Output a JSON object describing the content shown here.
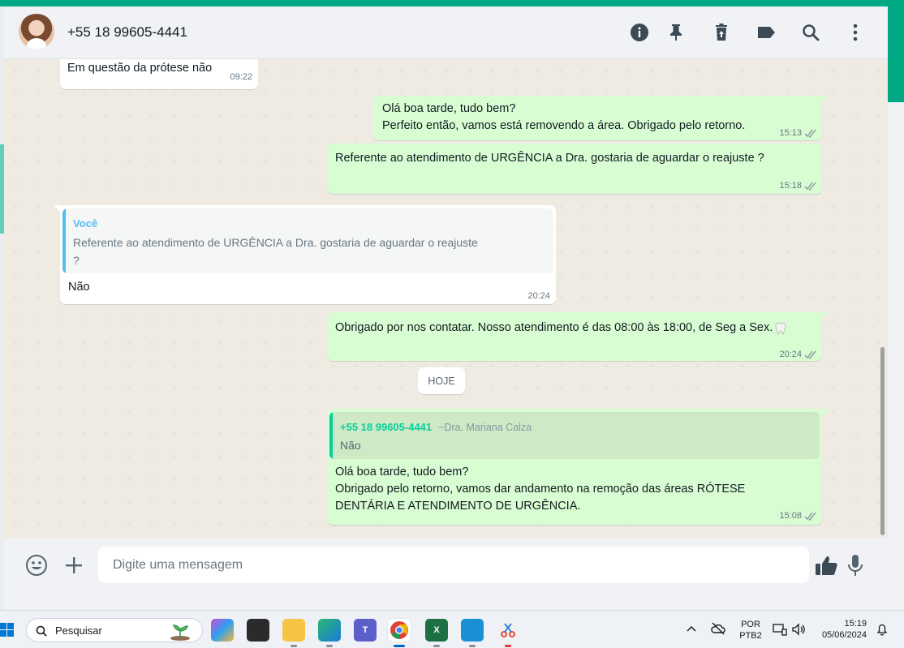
{
  "header": {
    "contact_name": "+55 18 99605-4441"
  },
  "messages": {
    "m1": {
      "text": "Em questão da prótese não",
      "time": "09:22"
    },
    "m2": {
      "line1": "Olá boa tarde, tudo bem?",
      "line2": "Perfeito então, vamos está removendo a área. Obrigado pelo retorno.",
      "time": "15:13"
    },
    "m3": {
      "text": "Referente ao atendimento de URGÊNCIA a Dra. gostaria de aguardar o reajuste ?",
      "time": "15:18"
    },
    "m4": {
      "quote_author": "Você",
      "quote_line1": "Referente ao atendimento de URGÊNCIA a Dra. gostaria de aguardar o reajuste",
      "quote_line2": "?",
      "text": "Não",
      "time": "20:24"
    },
    "m5": {
      "text": "Obrigado por nos contatar. Nosso atendimento é das 08:00 às 18:00, de Seg a Sex.",
      "time": "20:24"
    },
    "day_separator": "HOJE",
    "m6": {
      "quote_author": "+55 18 99605-4441",
      "quote_author_name": "~Dra. Mariana Calza",
      "quote_text": "Não",
      "line1": "Olá boa tarde, tudo bem?",
      "line2": "Obrigado pelo retorno, vamos dar andamento na remoção das áreas RÓTESE",
      "line3": "DENTÁRIA E ATENDIMENTO DE URGÊNCIA.",
      "time": "15:08"
    }
  },
  "composer": {
    "placeholder": "Digite uma mensagem"
  },
  "taskbar": {
    "search_label": "Pesquisar",
    "language_line1": "POR",
    "language_line2": "PTB2",
    "clock_time": "15:19",
    "clock_date": "05/06/2024"
  },
  "colors": {
    "accent": "#00a884",
    "outgoing_bubble": "#d9fdd3",
    "incoming_bubble": "#ffffff",
    "chat_background": "#efeae2",
    "quote_self": "#53bdeb",
    "quote_contact": "#06cf9c"
  },
  "icons": [
    "info-icon",
    "pin-icon",
    "delete-icon",
    "label-icon",
    "search-icon",
    "menu-icon",
    "emoji-icon",
    "plus-icon",
    "thumbs-up-icon",
    "microphone-icon",
    "tooth-icon"
  ]
}
